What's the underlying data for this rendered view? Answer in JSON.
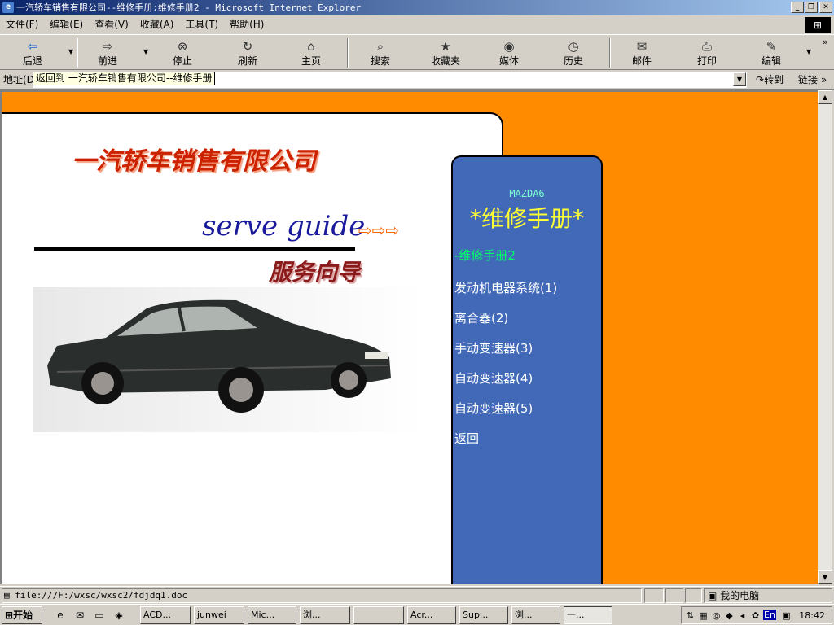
{
  "window": {
    "title": "一汽轿车销售有限公司--维修手册:维修手册2 - Microsoft Internet Explorer",
    "ie_icon": "e"
  },
  "menubar": [
    "文件(F)",
    "编辑(E)",
    "查看(V)",
    "收藏(A)",
    "工具(T)",
    "帮助(H)"
  ],
  "toolbar": {
    "back": "后退",
    "forward": "前进",
    "stop": "停止",
    "refresh": "刷新",
    "home": "主页",
    "search": "搜索",
    "favorites": "收藏夹",
    "media": "媒体",
    "history": "历史",
    "mail": "邮件",
    "print": "打印",
    "edit": "编辑"
  },
  "address_bar": {
    "label": "地址(D)",
    "value": "",
    "tooltip": "返回到 一汽轿车销售有限公司--维修手册",
    "go_label": "转到",
    "links_label": "链接"
  },
  "page": {
    "company": "一汽轿车销售有限公司",
    "serve_guide": "serve guide",
    "arrows": "⇨⇨⇨",
    "service_guide_cn": "服务向导",
    "model": "MAZDA6",
    "manual_title": "*维修手册*",
    "nav": [
      {
        "label": "-维修手册2",
        "current": true
      },
      {
        "label": "发动机电器系统(1)",
        "current": false
      },
      {
        "label": "离合器(2)",
        "current": false
      },
      {
        "label": "手动变速器(3)",
        "current": false
      },
      {
        "label": "自动变速器(4)",
        "current": false
      },
      {
        "label": "自动变速器(5)",
        "current": false
      },
      {
        "label": "返回",
        "current": false
      }
    ]
  },
  "statusbar": {
    "text": "file:///F:/wxsc/wxsc2/fdjdq1.doc",
    "zone": "我的电脑"
  },
  "taskbar": {
    "start": "开始",
    "tasks": [
      {
        "label": "ACD...",
        "active": false
      },
      {
        "label": "junwei",
        "active": false
      },
      {
        "label": "Mic...",
        "active": false
      },
      {
        "label": "浏...",
        "active": false
      },
      {
        "label": "",
        "active": false
      },
      {
        "label": "Acr...",
        "active": false
      },
      {
        "label": "Sup...",
        "active": false
      },
      {
        "label": "浏...",
        "active": false
      },
      {
        "label": "一...",
        "active": true
      }
    ],
    "input_lang": "En",
    "clock": "18:42"
  },
  "colors": {
    "page_bg": "#ff8c00",
    "nav_panel": "#4169b8",
    "nav_current": "#00ff66",
    "manual_title": "#ffff33",
    "company_red": "#cc2200",
    "serve_blue": "#1a1a9c"
  }
}
